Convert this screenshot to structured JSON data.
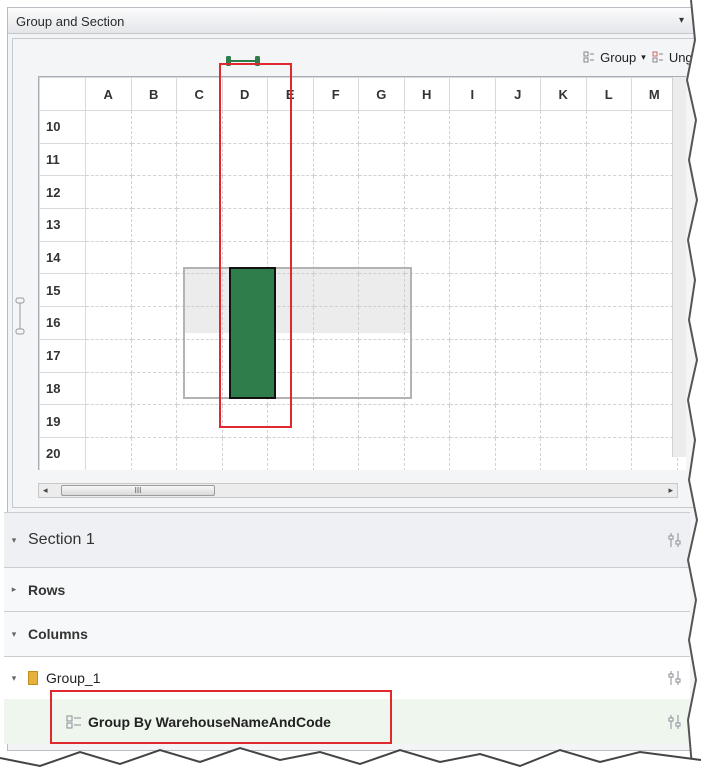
{
  "window": {
    "title": "Group and Section",
    "menu_arrow": "▾"
  },
  "toolbar": {
    "group_label": "Group",
    "ungroup_label": "Ungr",
    "caret": "▾",
    "group_icon": "group-icon",
    "ungroup_icon": "ungroup-icon"
  },
  "grid": {
    "columns": [
      "A",
      "B",
      "C",
      "D",
      "E",
      "F",
      "G",
      "H",
      "I",
      "J",
      "K",
      "L",
      "M"
    ],
    "rows": [
      "10",
      "11",
      "12",
      "13",
      "14",
      "15",
      "16",
      "17",
      "18",
      "19",
      "20"
    ],
    "selected_column": "D",
    "selected_rows": [
      "14",
      "15",
      "16",
      "17"
    ],
    "accent_color": "#2e7d4a",
    "highlight_color": "#e0292e"
  },
  "scrollbar": {
    "thumb_grip": "III",
    "left_arrow": "◂",
    "right_arrow": "▸"
  },
  "section": {
    "title": "Section 1",
    "rows_label": "Rows",
    "columns_label": "Columns",
    "group_label": "Group_1",
    "groupby_label": "Group By WarehouseNameAndCode",
    "expanded_arrow": "▾",
    "collapsed_arrow": "▸"
  }
}
